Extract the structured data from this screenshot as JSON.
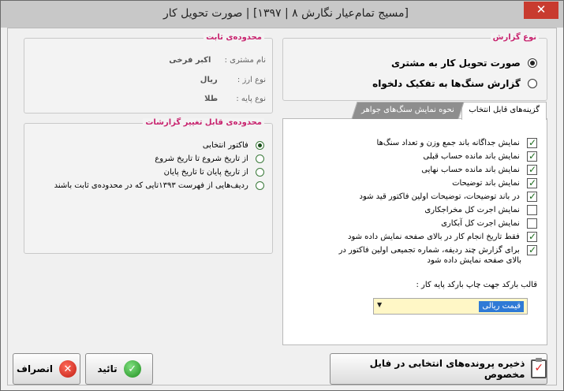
{
  "window": {
    "title": "[مسیج تمام‌عیار نگارش ۸ | ۱۳۹۷] | صورت تحویل کار",
    "close_glyph": "✕"
  },
  "fixed_area": {
    "legend": "محدوده‌ی ثابت",
    "fields": [
      {
        "label": "نام مشتری :",
        "value": "اکبر فرخی"
      },
      {
        "label": "نوع ارز :",
        "value": "ریال"
      },
      {
        "label": "نوع پایه :",
        "value": "طلا"
      }
    ]
  },
  "report_type": {
    "legend": "نوع گزارش",
    "options": [
      {
        "label": "صورت تحویل کار به مشتری",
        "selected": true
      },
      {
        "label": "گزارش سنگ‌ها به تفکیک دلخواه",
        "selected": false
      }
    ]
  },
  "report_range": {
    "legend": "محدوده‌ی قابل تغییر گزارشات",
    "options": [
      {
        "label": "فاکتور انتخابی",
        "selected": true
      },
      {
        "label": "از تاریخ شروع تا تاریخ شروع",
        "selected": false
      },
      {
        "label": "از تاریخ پایان تا تاریخ پایان",
        "selected": false
      },
      {
        "label": "ردیف‌هایی از فهرست ۱۳۹۳تایی که در محدوده‌ی ثابت باشند",
        "selected": false
      }
    ]
  },
  "tabs": [
    {
      "label": "گزینه‌های قابل انتخاب",
      "active": true
    },
    {
      "label": "نحوه نمایش سنگ‌های جواهر",
      "active": false
    }
  ],
  "options": [
    {
      "label": "نمایش جداگانه باند جمع وزن و تعداد سنگ‌ها",
      "checked": true
    },
    {
      "label": "نمایش باند مانده حساب قبلی",
      "checked": true
    },
    {
      "label": "نمایش باند مانده حساب نهایی",
      "checked": true
    },
    {
      "label": "نمایش باند توضیحات",
      "checked": true
    },
    {
      "label": "در باند توضیحات، توضیحات اولین فاکتور قید شود",
      "checked": true
    },
    {
      "label": "نمایش اجرت کل مخراجکاری",
      "checked": false
    },
    {
      "label": "نمایش اجرت کل آبکاری",
      "checked": false
    },
    {
      "label": "فقط تاریخ انجام کار در بالای صفحه نمایش داده شود",
      "checked": true
    },
    {
      "label": "برای گزارش چند ردیفه، شماره تجمیعی اولین فاکتور در",
      "label2": "بالای صفحه نمایش داده شود",
      "checked": true
    }
  ],
  "barcode": {
    "label": "قالب بارکد جهت چاپ بارکد پایه کار :",
    "selected": "قیمت ریالی"
  },
  "buttons": {
    "save": "ذخیره پرونده‌های انتخابی در فایل مخصوص",
    "confirm": "تائید",
    "cancel": "انصراف"
  }
}
